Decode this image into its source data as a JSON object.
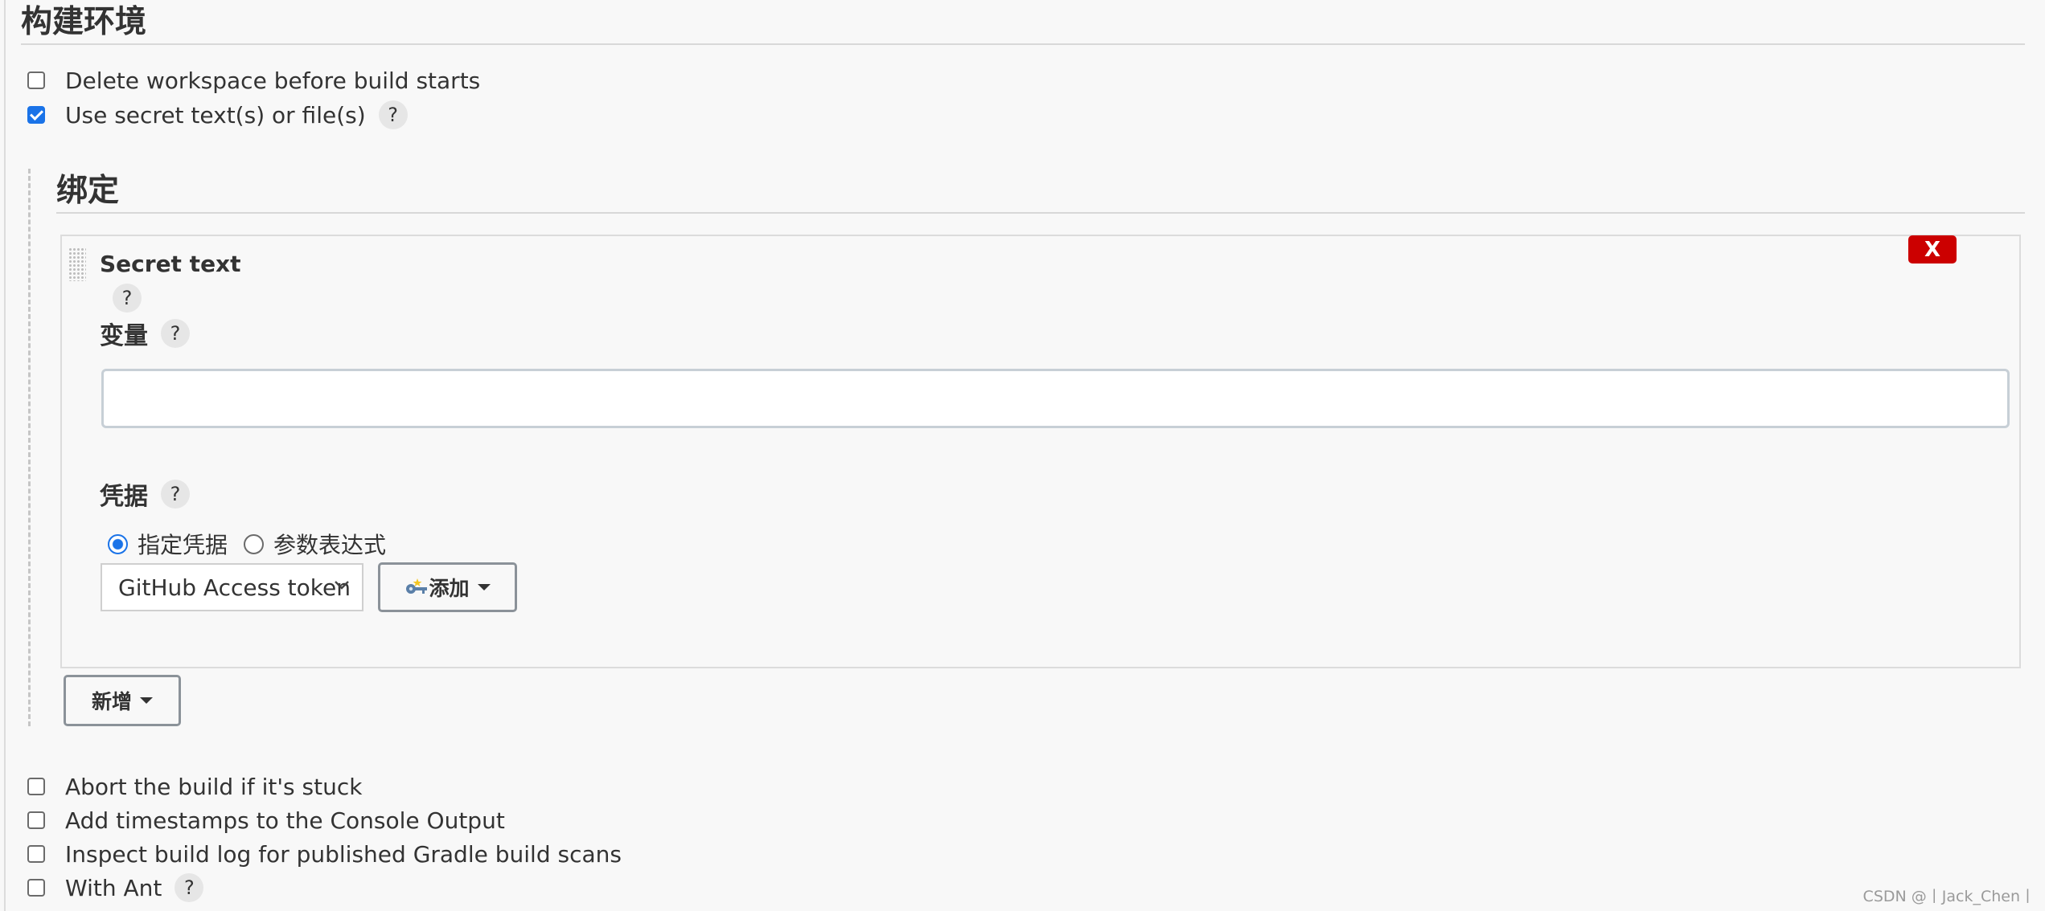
{
  "section": {
    "title": "构建环境",
    "options_top": [
      {
        "label": "Delete workspace before build starts",
        "checked": false,
        "help": ""
      },
      {
        "label": "Use secret text(s) or file(s)",
        "checked": true,
        "help": "?"
      }
    ],
    "options_bottom": [
      {
        "label": "Abort the build if it's stuck",
        "checked": false,
        "help": ""
      },
      {
        "label": "Add timestamps to the Console Output",
        "checked": false,
        "help": ""
      },
      {
        "label": "Inspect build log for published Gradle build scans",
        "checked": false,
        "help": ""
      },
      {
        "label": "With Ant",
        "checked": false,
        "help": "?"
      }
    ]
  },
  "bindings": {
    "title": "绑定",
    "item": {
      "title": "Secret text",
      "delete_label": "X",
      "help": "?",
      "variable": {
        "label": "变量",
        "help": "?",
        "value": "",
        "placeholder": ""
      },
      "credentials": {
        "label": "凭据",
        "help": "?",
        "radio_options": [
          {
            "label": "指定凭据",
            "selected": true
          },
          {
            "label": "参数表达式",
            "selected": false
          }
        ],
        "selected_credential": "GitHub Access token",
        "add_button": "添加",
        "add_icon": "key-icon"
      }
    },
    "new_button": "新增"
  },
  "watermark": "CSDN @丨Jack_Chen丨",
  "colors": {
    "background": "#f8f8f8",
    "checkbox_checked": "#1a73e8",
    "delete_button": "#cc0000",
    "button_border": "#8b9299"
  }
}
